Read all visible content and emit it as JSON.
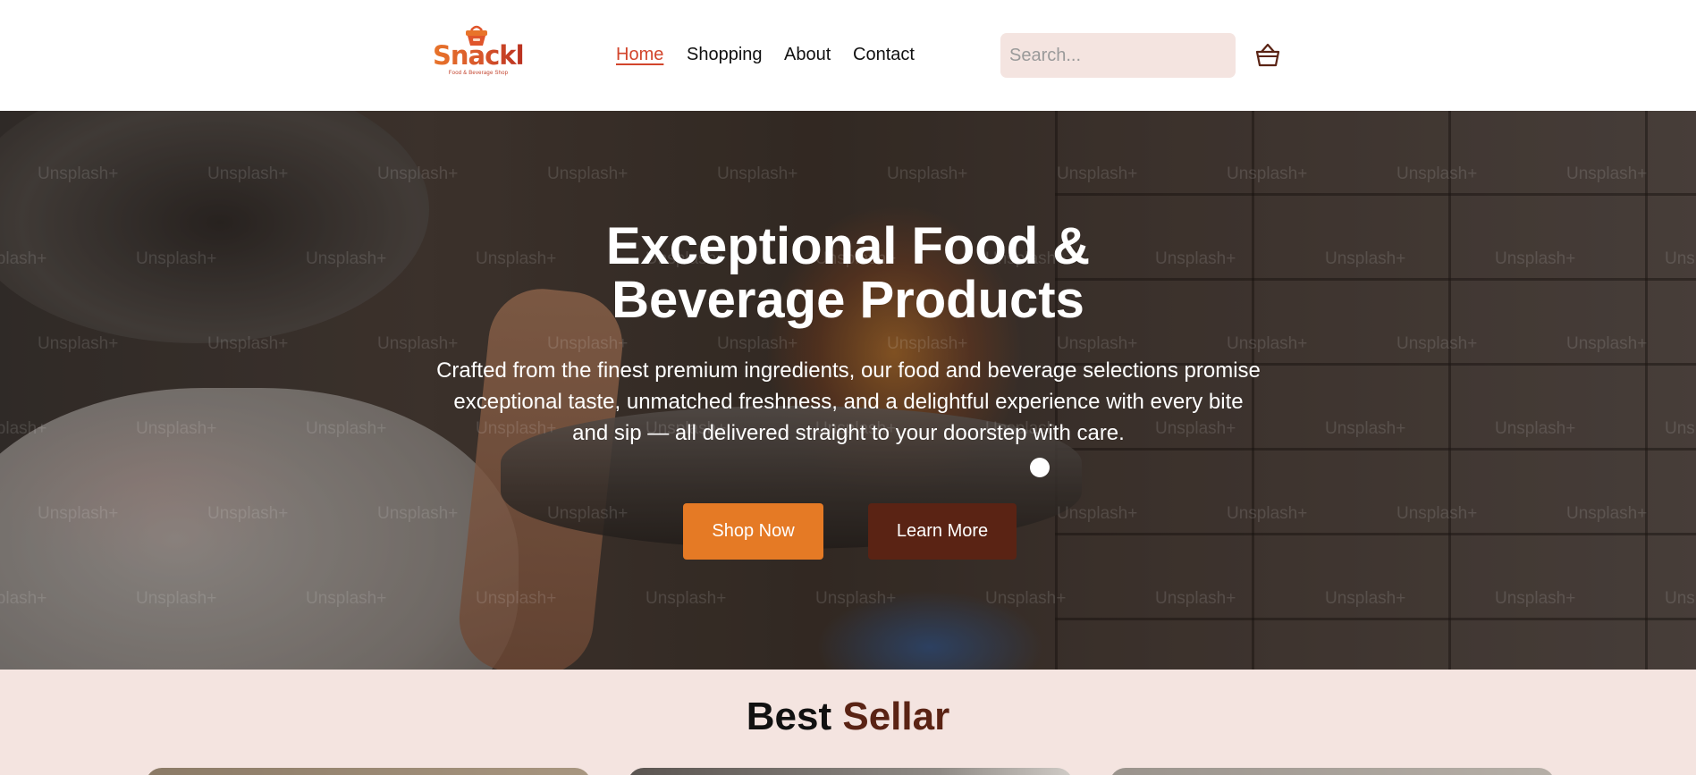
{
  "header": {
    "logo": {
      "brand": "Snackly",
      "tagline": "Food & Beverage Shop"
    },
    "nav": [
      {
        "label": "Home",
        "active": true
      },
      {
        "label": "Shopping",
        "active": false
      },
      {
        "label": "About",
        "active": false
      },
      {
        "label": "Contact",
        "active": false
      }
    ],
    "search": {
      "placeholder": "Search...",
      "value": ""
    },
    "cart_icon": "basket-icon"
  },
  "hero": {
    "title_line1": "Exceptional Food &",
    "title_line2": "Beverage Products",
    "subtitle": "Crafted from the finest premium ingredients, our food and beverage selections promise exceptional taste, unmatched freshness, and a delightful experience with every bite and sip — all delivered straight to your doorstep with care.",
    "watermark": "Unsplash+",
    "buttons": {
      "primary": "Shop Now",
      "secondary": "Learn More"
    }
  },
  "best_seller": {
    "title_part1": "Best",
    "title_part2": "Sellar"
  },
  "colors": {
    "accent_orange": "#e57a25",
    "accent_brown": "#5a2314",
    "nav_active": "#d2452c",
    "section_bg": "#f4e4e0"
  }
}
